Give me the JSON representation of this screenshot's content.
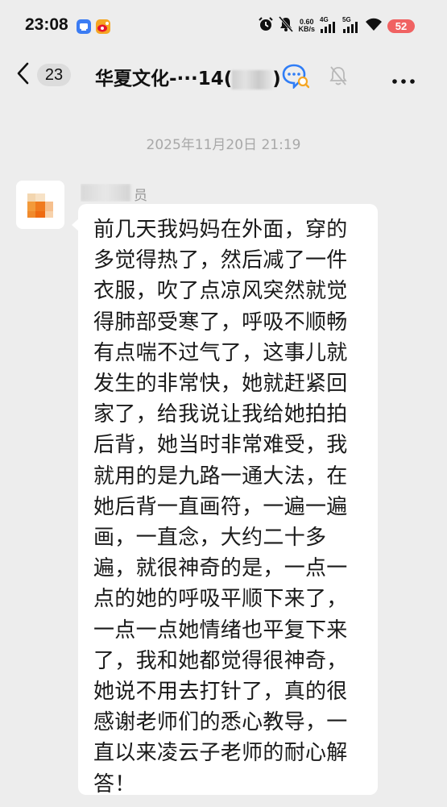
{
  "status_bar": {
    "time": "23:08",
    "net_speed_value": "0.60",
    "net_speed_unit": "KB/s",
    "signal_1_label": "4G",
    "signal_2_label": "5G",
    "battery_level": "52",
    "icons": [
      "message-app-icon",
      "weibo-icon",
      "alarm-icon",
      "mute-icon",
      "signal-icon",
      "wifi-icon",
      "battery-icon"
    ]
  },
  "nav": {
    "back_count": "23",
    "title_prefix": "华夏文化-···14(",
    "title_suffix": ")",
    "icons": [
      "back-chevron-icon",
      "chat-search-icon",
      "bell-muted-icon",
      "more-icon"
    ]
  },
  "chat": {
    "timestamp": "2025年11月20日 21:19",
    "sender_visible": "员",
    "message_lines": [
      "前几天我妈妈在外面，穿的",
      "多觉得热了，然后减了一件",
      "衣服，吹了点凉风突然就觉",
      "得肺部受寒了，呼吸不顺畅",
      "有点喘不过气了，这事儿就",
      "发生的非常快，她就赶紧回",
      "家了，给我说让我给她拍拍",
      "后背，她当时非常难受，我",
      "就用的是九路一通大法，在",
      "她后背一直画符，一遍一遍",
      "画，一直念，大约二十多",
      "遍，就很神奇的是，一点一",
      "点的她的呼吸平顺下来了，",
      "一点一点她情绪也平复下来",
      "了，我和她都觉得很神奇，",
      "她说不用去打针了，真的很",
      "感谢老师们的悉心教导，一",
      "直以来凌云子老师的耐心解",
      "答！"
    ]
  },
  "colors": {
    "background": "#ededed",
    "bubble": "#ffffff",
    "battery": "#f06262",
    "accent_blue": "#2f7df6"
  }
}
